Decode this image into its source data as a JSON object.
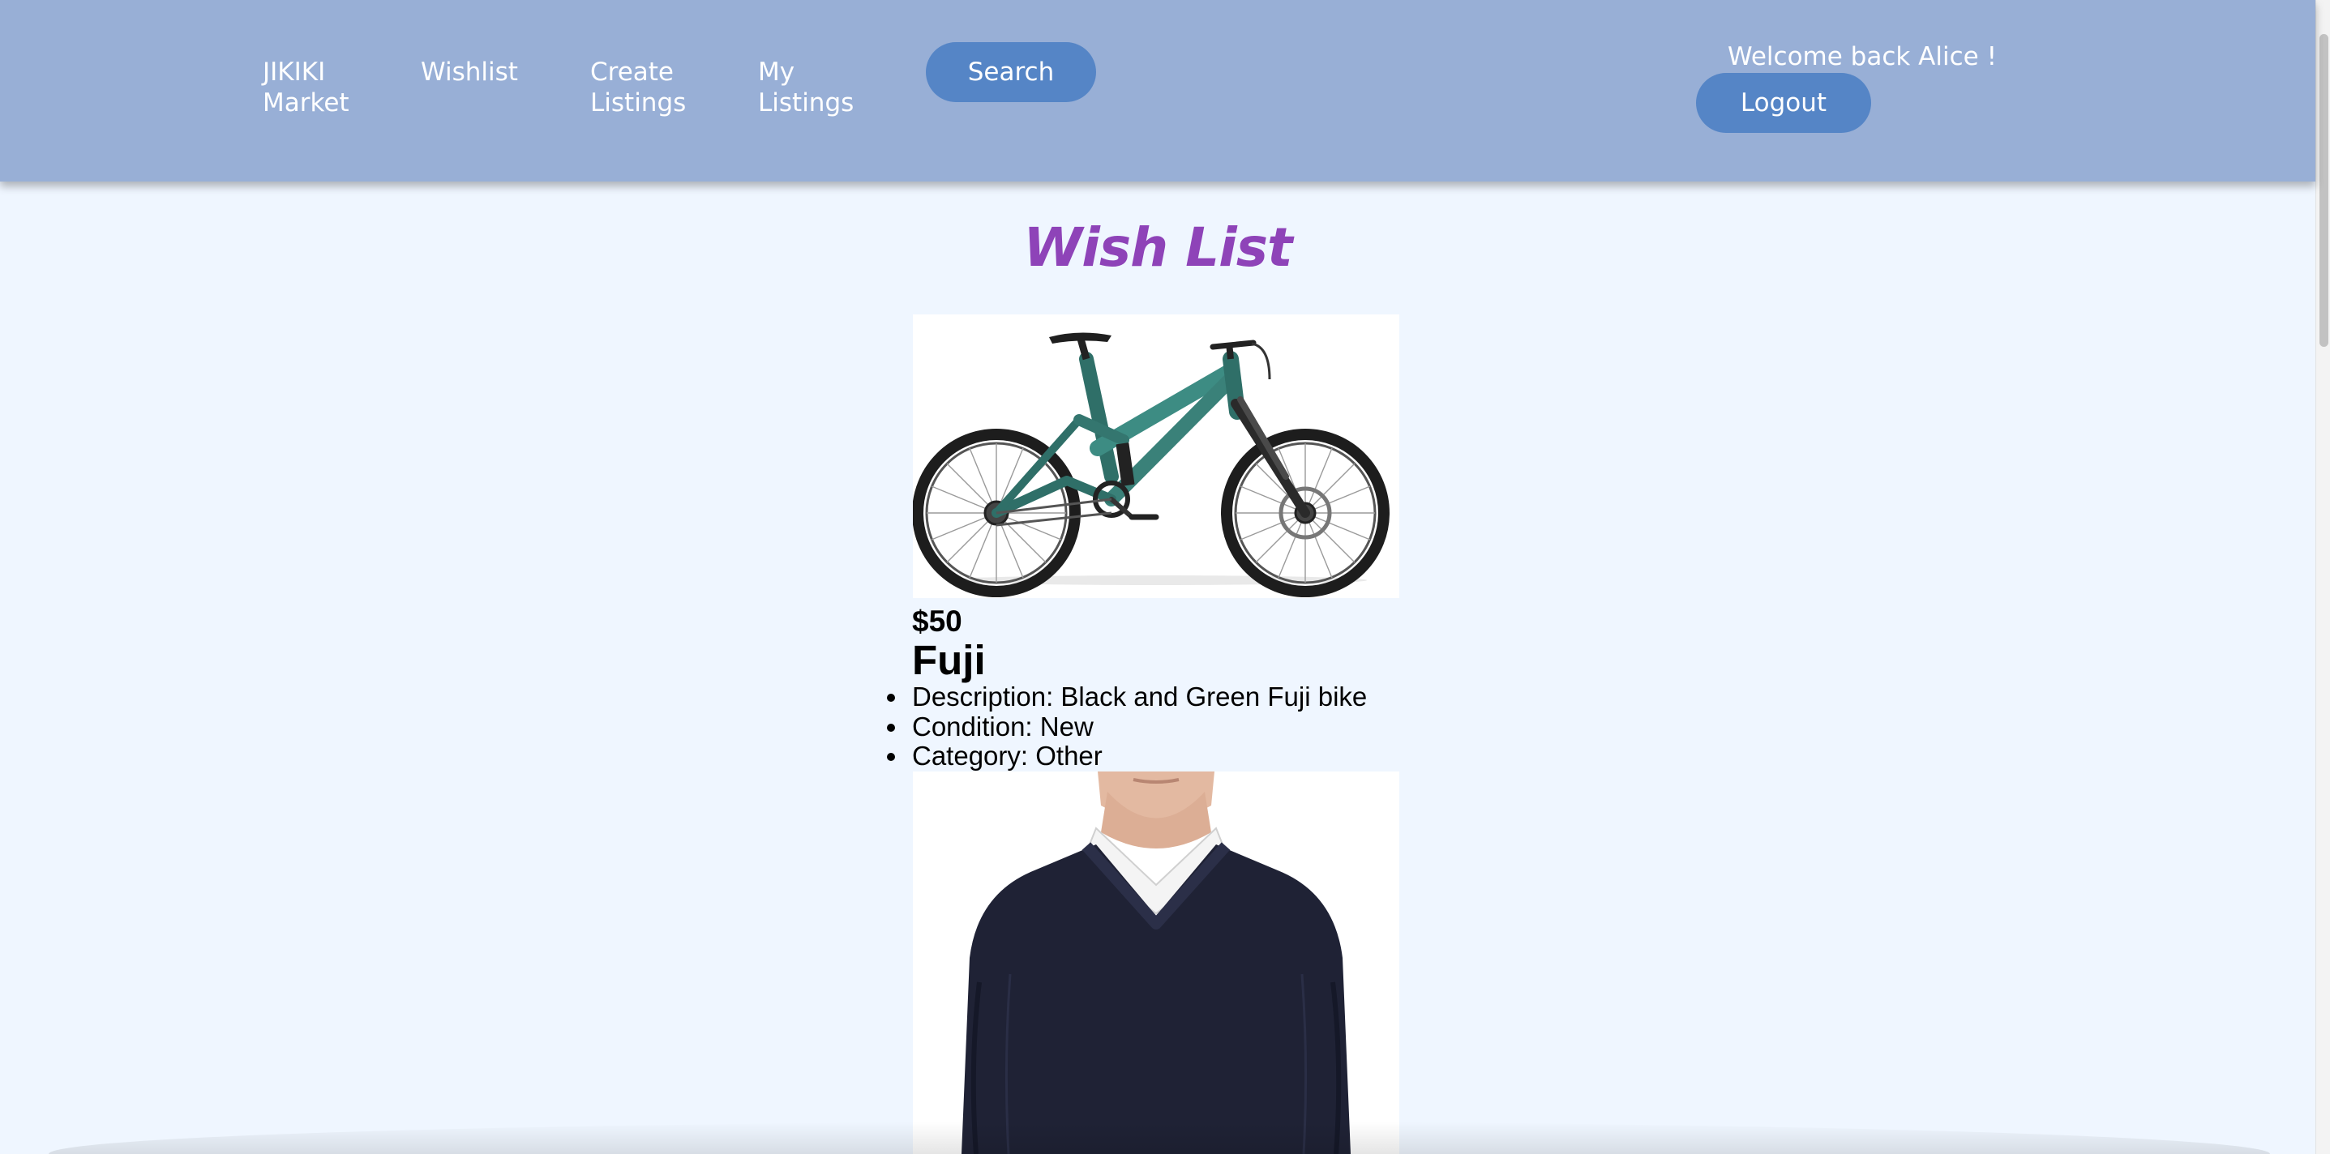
{
  "navbar": {
    "brand": "JIKIKI\nMarket",
    "links": [
      {
        "label": "Wishlist"
      },
      {
        "label": "Create\nListings"
      },
      {
        "label": "My\nListings"
      }
    ],
    "search_label": "Search",
    "welcome_text": "Welcome back Alice !",
    "logout_label": "Logout"
  },
  "main": {
    "title": "Wish List",
    "items": [
      {
        "price": "$50",
        "name": "Fuji",
        "details": [
          "Description: Black and Green Fuji bike",
          "Condition: New",
          "Category: Other"
        ],
        "image": "mountain-bike"
      },
      {
        "image": "navy-v-neck-sweater"
      }
    ]
  },
  "colors": {
    "navbar": "#98afd6",
    "button": "#5585c6",
    "title": "#8e43b8",
    "page_background": "#eff6ff"
  }
}
